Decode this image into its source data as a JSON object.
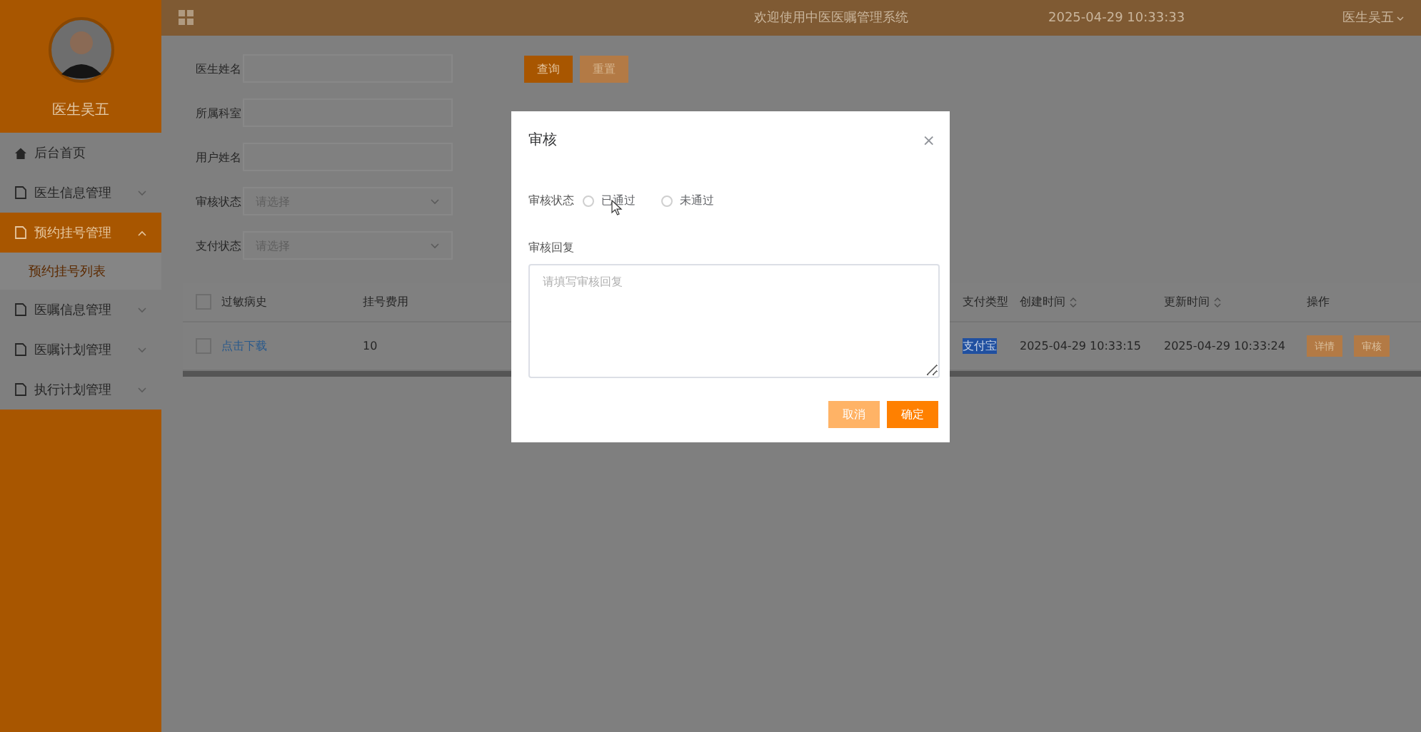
{
  "sidebar": {
    "user_name": "医生吴五",
    "menu": [
      {
        "label": "后台首页",
        "kind": "home",
        "selected": false
      },
      {
        "label": "医生信息管理",
        "kind": "group",
        "expanded": false,
        "selected": false
      },
      {
        "label": "预约挂号管理",
        "kind": "group",
        "expanded": true,
        "selected": true,
        "children": [
          {
            "label": "预约挂号列表",
            "selected": true
          }
        ]
      },
      {
        "label": "医嘱信息管理",
        "kind": "group",
        "expanded": false,
        "selected": false
      },
      {
        "label": "医嘱计划管理",
        "kind": "group",
        "expanded": false,
        "selected": false
      },
      {
        "label": "执行计划管理",
        "kind": "group",
        "expanded": false,
        "selected": false
      }
    ]
  },
  "header": {
    "title": "欢迎使用中医医嘱管理系统",
    "datetime": "2025-04-29 10:33:33",
    "user": "医生吴五"
  },
  "search_form": {
    "fields": [
      {
        "label": "医生姓名",
        "kind": "text"
      },
      {
        "label": "所属科室",
        "kind": "text"
      },
      {
        "label": "用户姓名",
        "kind": "text"
      },
      {
        "label": "审核状态",
        "kind": "select",
        "placeholder": "请选择"
      },
      {
        "label": "支付状态",
        "kind": "select",
        "placeholder": "请选择"
      }
    ],
    "buttons": [
      {
        "label": "查询",
        "kind": "primary"
      },
      {
        "label": "重置",
        "kind": "secondary"
      }
    ]
  },
  "table": {
    "all_checked": false,
    "columns": [
      {
        "label": "过敏病史",
        "sortable": false
      },
      {
        "label": "挂号费用",
        "sortable": false
      },
      {
        "label": "支付类型",
        "sortable": false
      },
      {
        "label": "创建时间",
        "sortable": true
      },
      {
        "label": "更新时间",
        "sortable": true
      },
      {
        "label": "操作",
        "sortable": false
      }
    ],
    "rows": [
      {
        "checked": false,
        "cells": [
          {
            "text": "点击下载",
            "kind": "link"
          },
          {
            "text": "10",
            "kind": "text"
          },
          {
            "text": "支付宝",
            "kind": "highlighted"
          },
          {
            "text": "2025-04-29 10:33:15",
            "kind": "text"
          },
          {
            "text": "2025-04-29 10:33:24",
            "kind": "text"
          }
        ],
        "actions": [
          {
            "label": "详情",
            "kind": "detail"
          },
          {
            "label": "审核",
            "kind": "review"
          }
        ]
      }
    ]
  },
  "dialog": {
    "title": "审核",
    "close": "×",
    "status_label": "审核状态",
    "options": [
      {
        "label": "已通过",
        "selected": false
      },
      {
        "label": "未通过",
        "selected": false
      }
    ],
    "reply_label": "审核回复",
    "reply_placeholder": "请填写审核回复",
    "buttons": [
      {
        "label": "取消",
        "kind": "cancel"
      },
      {
        "label": "确定",
        "kind": "confirm"
      }
    ]
  }
}
